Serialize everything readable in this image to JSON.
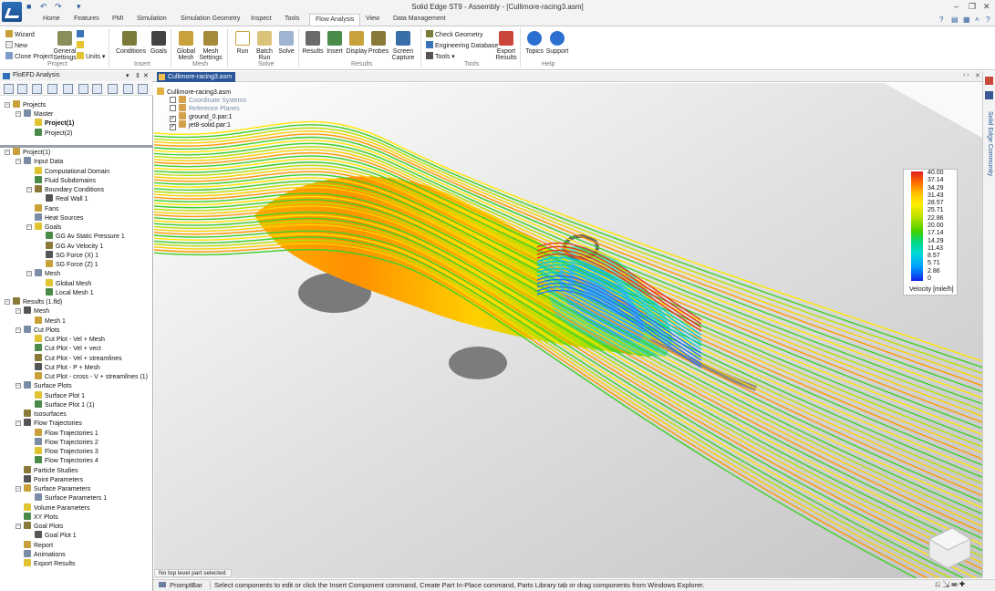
{
  "window": {
    "title": "Solid Edge ST9 - Assembly - [Cullimore-racing3.asm]",
    "controls": [
      "–",
      "❐",
      "✕"
    ]
  },
  "ribbon_tabs": [
    "Home",
    "Features",
    "PMI",
    "Simulation",
    "Simulation Geometry",
    "Inspect",
    "Tools",
    "Flow Analysis",
    "View",
    "Data Management"
  ],
  "active_tab": "Flow Analysis",
  "ribbon": {
    "project_small": [
      "Wizard",
      "New",
      "Clone Project"
    ],
    "general_settings": "General Settings",
    "units": "Units",
    "project_group": "Project",
    "conditions": "Conditions",
    "goals": "Goals",
    "insert_group": "Insert",
    "global_mesh": "Global Mesh",
    "mesh_settings": "Mesh Settings",
    "mesh_group": "Mesh",
    "run": "Run",
    "batch_run": "Batch Run",
    "solve": "Solve",
    "solve_group": "Solve",
    "results": "Results",
    "insert": "Insert",
    "display": "Display",
    "probes": "Probes",
    "screen_capture": "Screen Capture",
    "results_group": "Results",
    "check_geometry": "Check Geometry",
    "engineering_database": "Engineering Database",
    "tools": "Tools",
    "tools_group": "Tools",
    "export_results": "Export Results",
    "topics": "Topics",
    "support": "Support",
    "help_group": "Help"
  },
  "panel": {
    "title": "FloEFD Analysis",
    "controls": [
      "▾",
      "⇕",
      "✕"
    ],
    "projects_tree": [
      {
        "label": "Projects",
        "indent": 0,
        "exp": "−",
        "bold": false
      },
      {
        "label": "Master",
        "indent": 1,
        "exp": "−",
        "bold": false
      },
      {
        "label": "Project(1)",
        "indent": 2,
        "exp": "",
        "bold": true
      },
      {
        "label": "Project(2)",
        "indent": 2,
        "exp": "",
        "bold": false
      }
    ],
    "analysis_tree": [
      {
        "label": "Project(1)",
        "indent": 0,
        "exp": "−"
      },
      {
        "label": "Input Data",
        "indent": 1,
        "exp": "−"
      },
      {
        "label": "Computational Domain",
        "indent": 2,
        "exp": ""
      },
      {
        "label": "Fluid Subdomains",
        "indent": 2,
        "exp": ""
      },
      {
        "label": "Boundary Conditions",
        "indent": 2,
        "exp": "−"
      },
      {
        "label": "Real Wall 1",
        "indent": 3,
        "exp": ""
      },
      {
        "label": "Fans",
        "indent": 2,
        "exp": ""
      },
      {
        "label": "Heat Sources",
        "indent": 2,
        "exp": ""
      },
      {
        "label": "Goals",
        "indent": 2,
        "exp": "−"
      },
      {
        "label": "GG Av Static Pressure 1",
        "indent": 3,
        "exp": ""
      },
      {
        "label": "GG Av Velocity 1",
        "indent": 3,
        "exp": ""
      },
      {
        "label": "SG Force (X) 1",
        "indent": 3,
        "exp": ""
      },
      {
        "label": "SG Force (Z) 1",
        "indent": 3,
        "exp": ""
      },
      {
        "label": "Mesh",
        "indent": 2,
        "exp": "−"
      },
      {
        "label": "Global Mesh",
        "indent": 3,
        "exp": ""
      },
      {
        "label": "Local Mesh 1",
        "indent": 3,
        "exp": ""
      },
      {
        "label": "Results (1.fld)",
        "indent": 0,
        "exp": "−"
      },
      {
        "label": "Mesh",
        "indent": 1,
        "exp": "−"
      },
      {
        "label": "Mesh 1",
        "indent": 2,
        "exp": ""
      },
      {
        "label": "Cut Plots",
        "indent": 1,
        "exp": "−"
      },
      {
        "label": "Cut Plot  - Vel + Mesh",
        "indent": 2,
        "exp": ""
      },
      {
        "label": "Cut Plot  - Vel + vect",
        "indent": 2,
        "exp": ""
      },
      {
        "label": "Cut Plot  - Vel + streamlines",
        "indent": 2,
        "exp": ""
      },
      {
        "label": "Cut Plot  - P + Mesh",
        "indent": 2,
        "exp": ""
      },
      {
        "label": "Cut Plot  - cross - V + streamlines (1)",
        "indent": 2,
        "exp": ""
      },
      {
        "label": "Surface Plots",
        "indent": 1,
        "exp": "−"
      },
      {
        "label": "Surface Plot 1",
        "indent": 2,
        "exp": ""
      },
      {
        "label": "Surface Plot 1 (1)",
        "indent": 2,
        "exp": ""
      },
      {
        "label": "Isosurfaces",
        "indent": 1,
        "exp": ""
      },
      {
        "label": "Flow Trajectories",
        "indent": 1,
        "exp": "−"
      },
      {
        "label": "Flow Trajectories 1",
        "indent": 2,
        "exp": ""
      },
      {
        "label": "Flow Trajectories 2",
        "indent": 2,
        "exp": ""
      },
      {
        "label": "Flow Trajectories 3",
        "indent": 2,
        "exp": ""
      },
      {
        "label": "Flow Trajectories 4",
        "indent": 2,
        "exp": ""
      },
      {
        "label": "Particle Studies",
        "indent": 1,
        "exp": ""
      },
      {
        "label": "Point Parameters",
        "indent": 1,
        "exp": ""
      },
      {
        "label": "Surface Parameters",
        "indent": 1,
        "exp": "−"
      },
      {
        "label": "Surface Parameters 1",
        "indent": 2,
        "exp": ""
      },
      {
        "label": "Volume Parameters",
        "indent": 1,
        "exp": ""
      },
      {
        "label": "XY Plots",
        "indent": 1,
        "exp": ""
      },
      {
        "label": "Goal Plots",
        "indent": 1,
        "exp": "−"
      },
      {
        "label": "Goal Plot 1",
        "indent": 2,
        "exp": ""
      },
      {
        "label": "Report",
        "indent": 1,
        "exp": ""
      },
      {
        "label": "Animations",
        "indent": 1,
        "exp": ""
      },
      {
        "label": "Export Results",
        "indent": 1,
        "exp": ""
      }
    ]
  },
  "document": {
    "tab": "Cullimore-racing3.asm",
    "assembly_tree": [
      {
        "label": "Cullimore-racing3.asm",
        "indent": 0,
        "checkbox": false,
        "muted": false
      },
      {
        "label": "Coordinate Systems",
        "indent": 1,
        "checkbox": true,
        "checked": false,
        "muted": true
      },
      {
        "label": "Reference Planes",
        "indent": 1,
        "checkbox": true,
        "checked": false,
        "muted": true
      },
      {
        "label": "ground_0.par:1",
        "indent": 1,
        "checkbox": true,
        "checked": true,
        "muted": false
      },
      {
        "label": "jet8-solid.par:1",
        "indent": 1,
        "checkbox": true,
        "checked": true,
        "muted": false
      }
    ]
  },
  "legend": {
    "values": [
      "40.00",
      "37.14",
      "34.29",
      "31.43",
      "28.57",
      "25.71",
      "22.86",
      "20.00",
      "17.14",
      "14.29",
      "11.43",
      "8.57",
      "5.71",
      "2.86",
      "0"
    ],
    "title": "Velocity [mile/h]"
  },
  "side": {
    "community": "Solid Edge Community"
  },
  "status": {
    "selection": "No top level part selected.",
    "promptbar_label": "PromptBar",
    "prompt": "Select components to edit or click the Insert Component command, Create Part In-Place command, Parts Library tab or drag components from Windows Explorer."
  },
  "colors": {
    "accent": "#2b579a",
    "streamline_red": "#e53020",
    "streamline_yellow": "#ffe600",
    "streamline_green": "#3ed02a",
    "streamline_blue": "#1c70ff"
  }
}
